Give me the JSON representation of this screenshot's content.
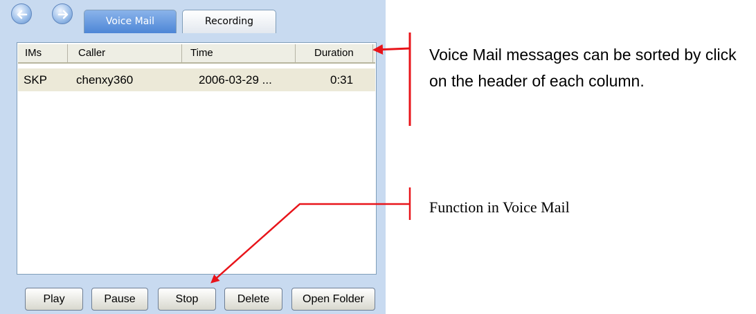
{
  "tabs": [
    {
      "label": "Voice Mail",
      "active": true
    },
    {
      "label": "Recording",
      "active": false
    }
  ],
  "nav": {
    "back_icon": "back-arrow-icon",
    "forward_icon": "forward-arrow-icon"
  },
  "list": {
    "columns": [
      "IMs",
      "Caller",
      "Time",
      "Duration"
    ],
    "rows": [
      {
        "ims": "SKP",
        "caller": "chenxy360",
        "time": "2006-03-29 ...",
        "duration": "0:31"
      }
    ]
  },
  "buttons": [
    "Play",
    "Pause",
    "Stop",
    "Delete",
    "Open Folder"
  ],
  "annotations": {
    "sort_note": "Voice Mail messages can be sorted by click on the header of each column.",
    "function_note": "Function in Voice Mail"
  },
  "colors": {
    "arrow": "#e8141a",
    "tab_active": "#4d86d6",
    "selected_row": "#ece9d8"
  }
}
